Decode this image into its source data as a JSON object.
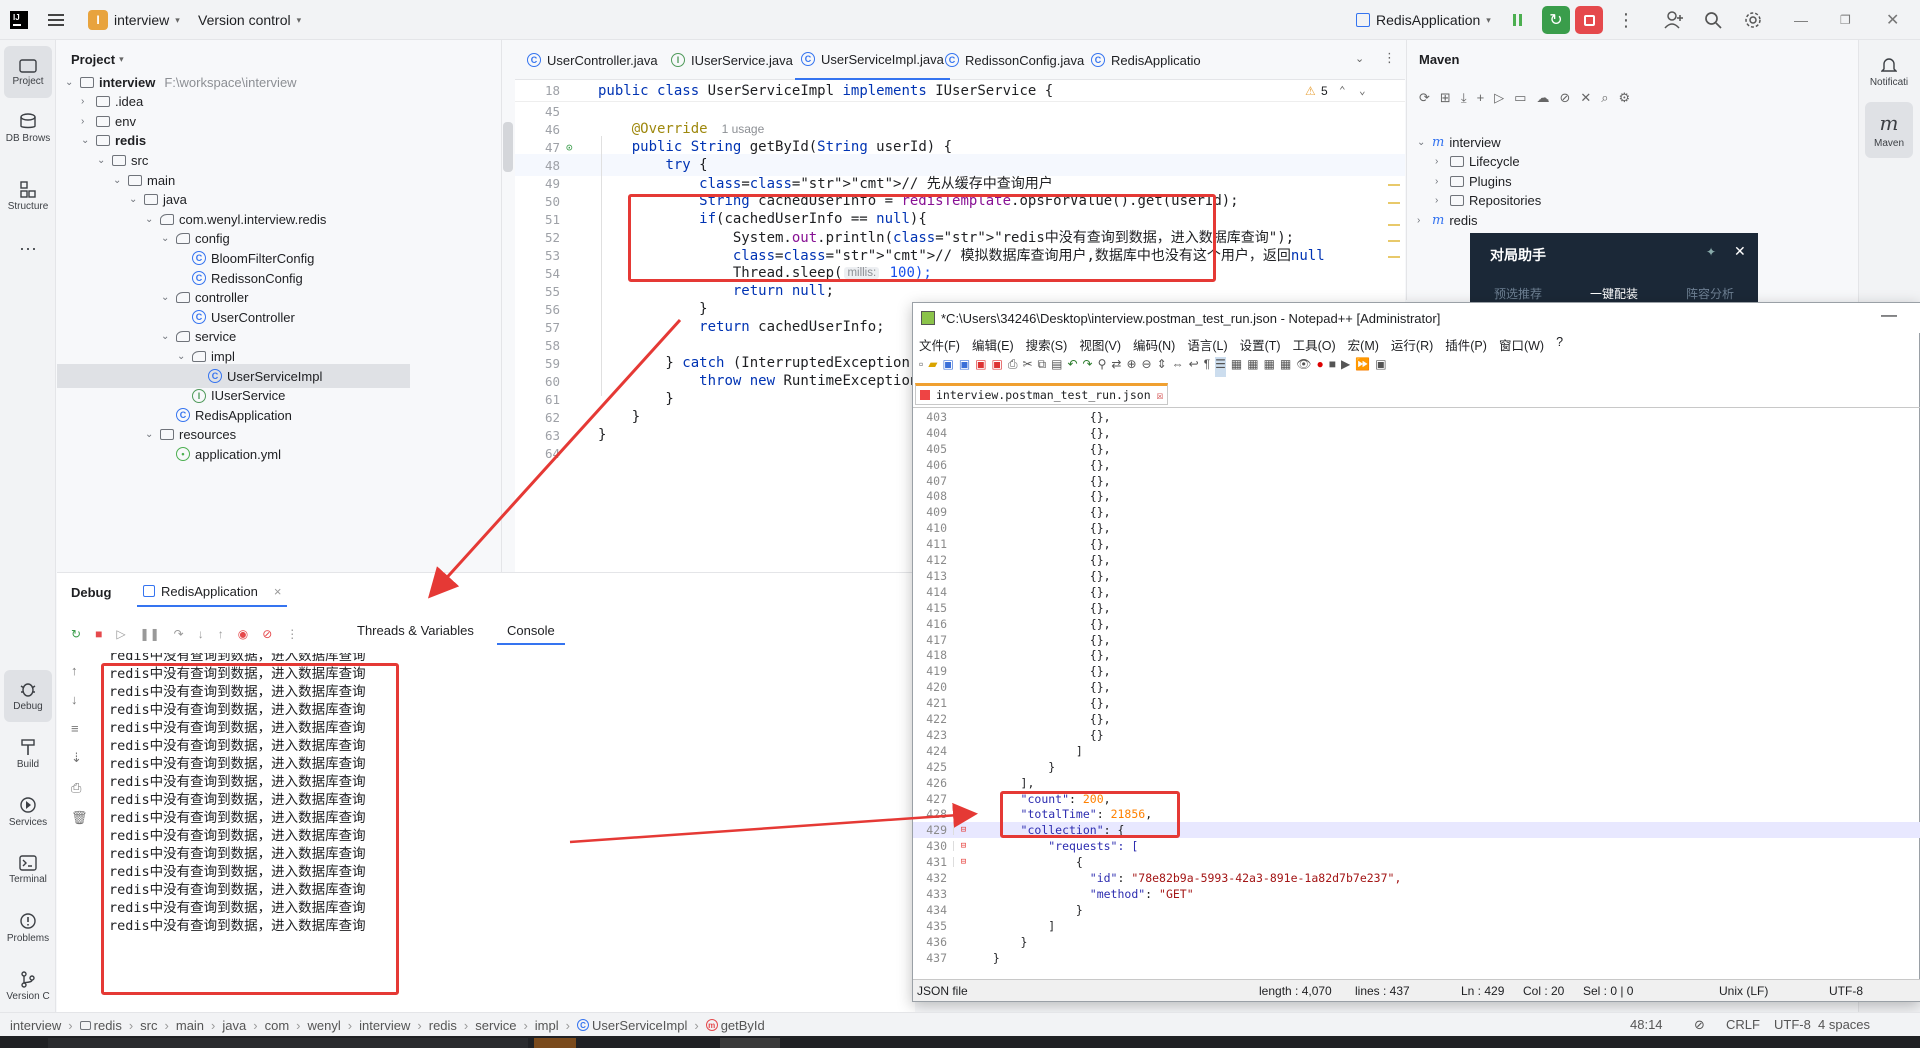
{
  "titlebar": {
    "app_letter": "I",
    "project_name": "interview",
    "vcs": "Version control",
    "run_config": "RedisApplication"
  },
  "left_stripe": {
    "items": [
      "Project",
      "DB Brows",
      "Structure",
      "Debug",
      "Build",
      "Services",
      "Terminal",
      "Problems",
      "Version C"
    ]
  },
  "right_stripe": {
    "items": [
      "Notificati",
      "Maven"
    ]
  },
  "project": {
    "title": "Project",
    "tree": [
      {
        "label": "interview",
        "extra": "F:\\workspace\\interview"
      },
      {
        "label": ".idea"
      },
      {
        "label": "env"
      },
      {
        "label": "redis"
      },
      {
        "label": "src"
      },
      {
        "label": "main"
      },
      {
        "label": "java"
      },
      {
        "label": "com.wenyl.interview.redis"
      },
      {
        "label": "config"
      },
      {
        "label": "BloomFilterConfig"
      },
      {
        "label": "RedissonConfig"
      },
      {
        "label": "controller"
      },
      {
        "label": "UserController"
      },
      {
        "label": "service"
      },
      {
        "label": "impl"
      },
      {
        "label": "UserServiceImpl"
      },
      {
        "label": "IUserService"
      },
      {
        "label": "RedisApplication"
      },
      {
        "label": "resources"
      },
      {
        "label": "application.yml"
      }
    ]
  },
  "editor": {
    "tabs": [
      "UserController.java",
      "IUserService.java",
      "UserServiceImpl.java",
      "RedissonConfig.java",
      "RedisApplicatio"
    ],
    "warning_count": "5",
    "sticky": {
      "ln": "18",
      "text": "public class UserServiceImpl implements IUserService {"
    },
    "lines": [
      {
        "ln": "45",
        "text": ""
      },
      {
        "ln": "46",
        "text": "    @Override",
        "usage": "1 usage"
      },
      {
        "ln": "47",
        "text": "    public String getById(String userId) {"
      },
      {
        "ln": "48",
        "text": "        try {"
      },
      {
        "ln": "49",
        "text": "            // 先从缓存中查询用户"
      },
      {
        "ln": "50",
        "text": "            String cachedUserInfo = redisTemplate.opsForValue().get(userId);"
      },
      {
        "ln": "51",
        "text": "            if(cachedUserInfo == null){"
      },
      {
        "ln": "52",
        "text": "                System.out.println(\"redis中没有查询到数据，进入数据库查询\");"
      },
      {
        "ln": "53",
        "text": "                // 模拟数据库查询用户,数据库中也没有这个用户，返回null"
      },
      {
        "ln": "54",
        "text": "                Thread.sleep(",
        "hint": "millis:",
        "tail": " 100);"
      },
      {
        "ln": "55",
        "text": "                return null;"
      },
      {
        "ln": "56",
        "text": "            }"
      },
      {
        "ln": "57",
        "text": "            return cachedUserInfo;"
      },
      {
        "ln": "58",
        "text": ""
      },
      {
        "ln": "59",
        "text": "        } catch (InterruptedException e) {"
      },
      {
        "ln": "60",
        "text": "            throw new RuntimeException(e);"
      },
      {
        "ln": "61",
        "text": "        }"
      },
      {
        "ln": "62",
        "text": "    }"
      },
      {
        "ln": "63",
        "text": "}"
      },
      {
        "ln": "64",
        "text": ""
      }
    ]
  },
  "maven": {
    "title": "Maven",
    "tree": [
      "interview",
      "Lifecycle",
      "Plugins",
      "Repositories",
      "redis"
    ]
  },
  "helper": {
    "title": "对局助手",
    "tabs": [
      "预选推荐",
      "一键配装",
      "阵容分析"
    ]
  },
  "debug": {
    "title": "Debug",
    "session": "RedisApplication",
    "tabs": [
      "Threads & Variables",
      "Console"
    ],
    "console_line": "redis中没有查询到数据，进入数据库查询",
    "console_count": 16
  },
  "notepad": {
    "title": "*C:\\Users\\34246\\Desktop\\interview.postman_test_run.json - Notepad++ [Administrator]",
    "menu": [
      "文件(F)",
      "编辑(E)",
      "搜索(S)",
      "视图(V)",
      "编码(N)",
      "语言(L)",
      "设置(T)",
      "工具(O)",
      "宏(M)",
      "运行(R)",
      "插件(P)",
      "窗口(W)",
      "?"
    ],
    "file_tab": "interview.postman_test_run.json",
    "status": {
      "type": "JSON file",
      "length": "length : 4,070",
      "lines": "lines : 437",
      "ln": "Ln : 429",
      "col": "Col : 20",
      "sel": "Sel : 0 | 0",
      "eol": "Unix (LF)",
      "enc": "UTF-8"
    },
    "lines": [
      {
        "ln": "403",
        "text": "                {},"
      },
      {
        "ln": "404",
        "text": "                {},"
      },
      {
        "ln": "405",
        "text": "                {},"
      },
      {
        "ln": "406",
        "text": "                {},"
      },
      {
        "ln": "407",
        "text": "                {},"
      },
      {
        "ln": "408",
        "text": "                {},"
      },
      {
        "ln": "409",
        "text": "                {},"
      },
      {
        "ln": "410",
        "text": "                {},"
      },
      {
        "ln": "411",
        "text": "                {},"
      },
      {
        "ln": "412",
        "text": "                {},"
      },
      {
        "ln": "413",
        "text": "                {},"
      },
      {
        "ln": "414",
        "text": "                {},"
      },
      {
        "ln": "415",
        "text": "                {},"
      },
      {
        "ln": "416",
        "text": "                {},"
      },
      {
        "ln": "417",
        "text": "                {},"
      },
      {
        "ln": "418",
        "text": "                {},"
      },
      {
        "ln": "419",
        "text": "                {},"
      },
      {
        "ln": "420",
        "text": "                {},"
      },
      {
        "ln": "421",
        "text": "                {},"
      },
      {
        "ln": "422",
        "text": "                {},"
      },
      {
        "ln": "423",
        "text": "                {}"
      },
      {
        "ln": "424",
        "text": "              ]"
      },
      {
        "ln": "425",
        "text": "          }"
      },
      {
        "ln": "426",
        "text": "      ],"
      },
      {
        "ln": "427",
        "key": "\"count\"",
        "val": "200",
        "num": true,
        "tail": ","
      },
      {
        "ln": "428",
        "key": "\"totalTime\"",
        "val": "21856",
        "num": true,
        "tail": ","
      },
      {
        "ln": "429",
        "key": "\"collection\"",
        "val": "{",
        "num": false,
        "tail": ""
      },
      {
        "ln": "430",
        "text": "          \"requests\": [",
        "keyline": true
      },
      {
        "ln": "431",
        "text": "              {"
      },
      {
        "ln": "432",
        "key2": "\"id\"",
        "val2": "\"78e82b9a-5993-42a3-891e-1a82d7b7e237\","
      },
      {
        "ln": "433",
        "key2": "\"method\"",
        "val2": "\"GET\""
      },
      {
        "ln": "434",
        "text": "              }"
      },
      {
        "ln": "435",
        "text": "          ]"
      },
      {
        "ln": "436",
        "text": "      }"
      },
      {
        "ln": "437",
        "text": "  }"
      }
    ]
  },
  "statusbar": {
    "breadcrumb": [
      "interview",
      "redis",
      "src",
      "main",
      "java",
      "com",
      "wenyl",
      "interview",
      "redis",
      "service",
      "impl",
      "UserServiceImpl",
      "getById"
    ],
    "position": "48:14",
    "eol": "CRLF",
    "encoding": "UTF-8",
    "indent": "4 spaces"
  }
}
